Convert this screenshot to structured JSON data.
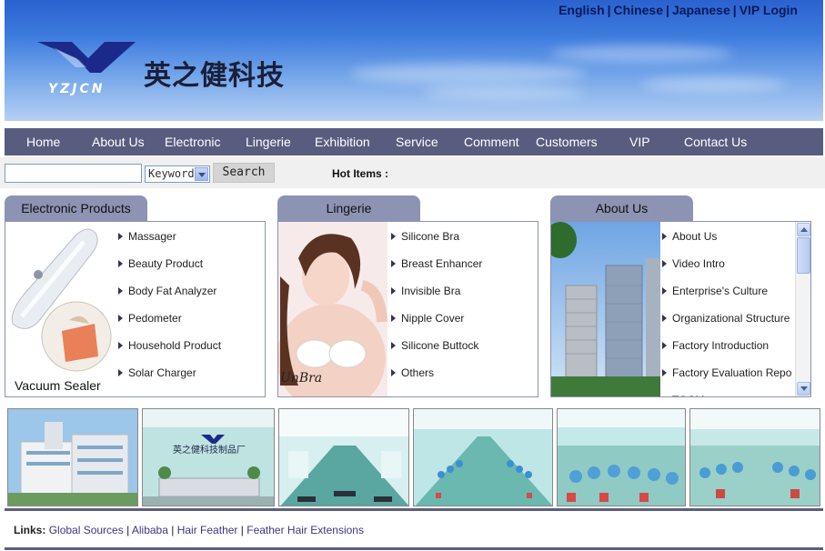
{
  "header": {
    "languages": [
      "English",
      "Chinese",
      "Japanese",
      "VIP Login"
    ],
    "separator": "|",
    "logo_text": "YZJCN",
    "company_name_cn": "英之健科技"
  },
  "nav": {
    "items": [
      "Home",
      "About Us",
      "Electronic",
      "Lingerie",
      "Exhibition",
      "Service",
      "Comment",
      "Customers",
      "VIP",
      "Contact Us"
    ]
  },
  "search": {
    "input_value": "",
    "select_value": "Keyword",
    "button_label": "Search",
    "hot_items_label": "Hot Items :"
  },
  "panels": {
    "electronic": {
      "title": "Electronic Products",
      "image_caption": "Vacuum Sealer",
      "items": [
        "Massager",
        "Beauty Product",
        "Body Fat Analyzer",
        "Pedometer",
        "Household Product",
        "Solar Charger"
      ]
    },
    "lingerie": {
      "title": "Lingerie",
      "image_caption": "UnBra",
      "items": [
        "Silicone Bra",
        "Breast Enhancer",
        "Invisible Bra",
        "Nipple Cover",
        "Silicone Buttock",
        "Others"
      ]
    },
    "about": {
      "title": "About  Us",
      "items": [
        "About Us",
        "Video Intro",
        "Enterprise's Culture",
        "Organizational Structure",
        "Factory Introduction",
        "Factory Evaluation Repo",
        "TQCM"
      ]
    }
  },
  "photos": {
    "factory_sign_text": "英之健科技制品厂",
    "count": 6
  },
  "footer": {
    "links_label": "Links:",
    "links": [
      "Global Sources",
      "Alibaba",
      "Hair Feather",
      "Feather Hair Extensions"
    ],
    "separator": "|"
  },
  "colors": {
    "nav_bg": "#585d7f",
    "tab_bg": "#8d93b3",
    "banner_blue": "#2a62cf",
    "link_color": "#3c3580"
  }
}
